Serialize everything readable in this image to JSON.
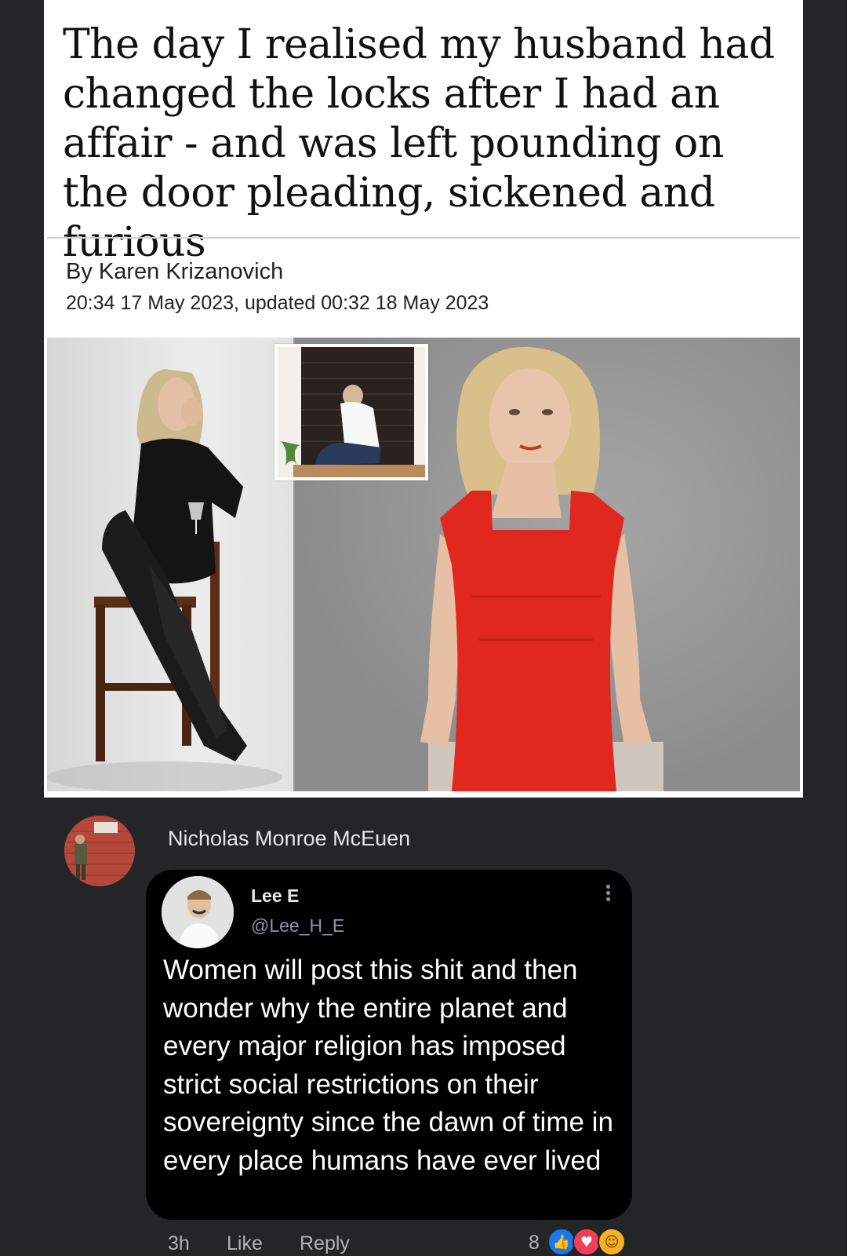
{
  "article": {
    "headline": "The day I realised my husband had changed the locks after I had an affair - and was left pounding on the door pleading, sickened and furious",
    "byline": "By Karen Krizanovich",
    "dateline": "20:34 17 May 2023, updated 00:32 18 May 2023"
  },
  "comment": {
    "author": "Nicholas Monroe McEuen",
    "tweet": {
      "name": "Lee E",
      "handle": "@Lee_H_E",
      "text": "Women will post this shit and then wonder why the entire planet and every major religion has imposed strict social restrictions on their sovereignty since the dawn of time in every place humans have ever lived"
    },
    "actions": {
      "time": "3h",
      "like_label": "Like",
      "reply_label": "Reply",
      "reaction_count": "8"
    },
    "reactions": [
      "like-icon",
      "love-icon",
      "haha-icon"
    ]
  },
  "colors": {
    "background": "#242526",
    "like_blue": "#1877f2",
    "love_red": "#f33e58",
    "haha_yellow": "#f7b125",
    "dress_red": "#e0281e"
  }
}
